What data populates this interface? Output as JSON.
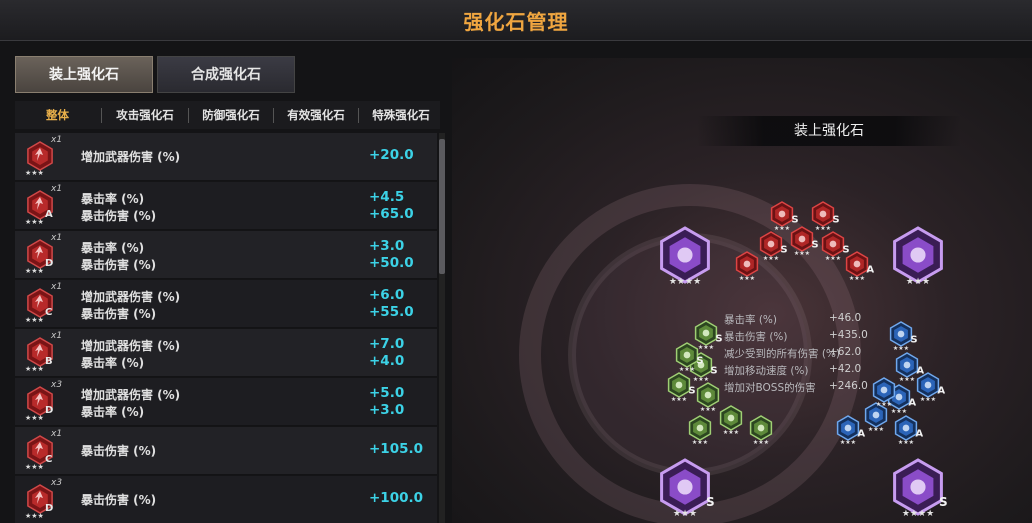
{
  "title": "强化石管理",
  "tabs": [
    {
      "label": "装上强化石",
      "active": true
    },
    {
      "label": "合成强化石",
      "active": false
    }
  ],
  "subtabs": [
    {
      "label": "整体",
      "active": true
    },
    {
      "label": "攻击强化石",
      "active": false
    },
    {
      "label": "防御强化石",
      "active": false
    },
    {
      "label": "有效强化石",
      "active": false
    },
    {
      "label": "特殊强化石",
      "active": false
    }
  ],
  "rows": [
    {
      "qty": "x1",
      "grade": "",
      "stars": "★★★",
      "stats": [
        {
          "name": "增加武器伤害 (%)",
          "value": "+20.0"
        }
      ]
    },
    {
      "qty": "x1",
      "grade": "A",
      "stars": "★★★",
      "stats": [
        {
          "name": "暴击率 (%)",
          "value": "+4.5"
        },
        {
          "name": "暴击伤害 (%)",
          "value": "+65.0"
        }
      ]
    },
    {
      "qty": "x1",
      "grade": "D",
      "stars": "★★★",
      "stats": [
        {
          "name": "暴击率 (%)",
          "value": "+3.0"
        },
        {
          "name": "暴击伤害 (%)",
          "value": "+50.0"
        }
      ]
    },
    {
      "qty": "x1",
      "grade": "C",
      "stars": "★★★",
      "stats": [
        {
          "name": "增加武器伤害 (%)",
          "value": "+6.0"
        },
        {
          "name": "暴击伤害 (%)",
          "value": "+55.0"
        }
      ]
    },
    {
      "qty": "x1",
      "grade": "B",
      "stars": "★★★",
      "stats": [
        {
          "name": "增加武器伤害 (%)",
          "value": "+7.0"
        },
        {
          "name": "暴击率 (%)",
          "value": "+4.0"
        }
      ]
    },
    {
      "qty": "x3",
      "grade": "D",
      "stars": "★★★",
      "stats": [
        {
          "name": "增加武器伤害 (%)",
          "value": "+5.0"
        },
        {
          "name": "暴击率 (%)",
          "value": "+3.0"
        }
      ]
    },
    {
      "qty": "x1",
      "grade": "C",
      "stars": "★★★",
      "stats": [
        {
          "name": "暴击伤害 (%)",
          "value": "+105.0"
        }
      ]
    },
    {
      "qty": "x3",
      "grade": "D",
      "stars": "★★★",
      "stats": [
        {
          "name": "暴击伤害 (%)",
          "value": "+100.0"
        }
      ]
    }
  ],
  "panel": {
    "title": "装上强化石",
    "summary": [
      {
        "name": "暴击率 (%)",
        "value": "+46.0"
      },
      {
        "name": "暴击伤害 (%)",
        "value": "+435.0"
      },
      {
        "name": "减少受到的所有伤害 (%)",
        "value": "+62.0"
      },
      {
        "name": "增加移动速度 (%)",
        "value": "+42.0"
      },
      {
        "name": "增加对BOSS的伤害",
        "value": "+246.0"
      }
    ]
  },
  "slots": {
    "purple": [
      {
        "grade": "",
        "stars": "★★★★"
      },
      {
        "grade": "",
        "stars": "★★★"
      },
      {
        "grade": "S",
        "stars": "★★★"
      },
      {
        "grade": "S",
        "stars": "★★★★"
      }
    ],
    "red": [
      {
        "grade": "S",
        "stars": "★★★"
      },
      {
        "grade": "S",
        "stars": "★★★"
      },
      {
        "grade": "S",
        "stars": "★★★"
      },
      {
        "grade": "S",
        "stars": "★★★"
      },
      {
        "grade": "S",
        "stars": "★★★"
      },
      {
        "grade": "",
        "stars": "★★★"
      },
      {
        "grade": "A",
        "stars": "★★★"
      }
    ],
    "green": [
      {
        "grade": "S",
        "stars": "★★★"
      },
      {
        "grade": "S",
        "stars": "★★★"
      },
      {
        "grade": "S",
        "stars": "★★★"
      },
      {
        "grade": "",
        "stars": "★★★"
      },
      {
        "grade": "",
        "stars": "★★★"
      },
      {
        "grade": "",
        "stars": "★★★"
      },
      {
        "grade": "",
        "stars": "★★★"
      },
      {
        "grade": "S",
        "stars": "★★★"
      }
    ],
    "blue": [
      {
        "grade": "S",
        "stars": "★★★"
      },
      {
        "grade": "A",
        "stars": "★★★"
      },
      {
        "grade": "A",
        "stars": "★★★"
      },
      {
        "grade": "A",
        "stars": "★★★"
      },
      {
        "grade": "",
        "stars": "★★★"
      },
      {
        "grade": "A",
        "stars": "★★★"
      },
      {
        "grade": "A",
        "stars": "★★★"
      },
      {
        "grade": "",
        "stars": "★★★"
      }
    ]
  }
}
